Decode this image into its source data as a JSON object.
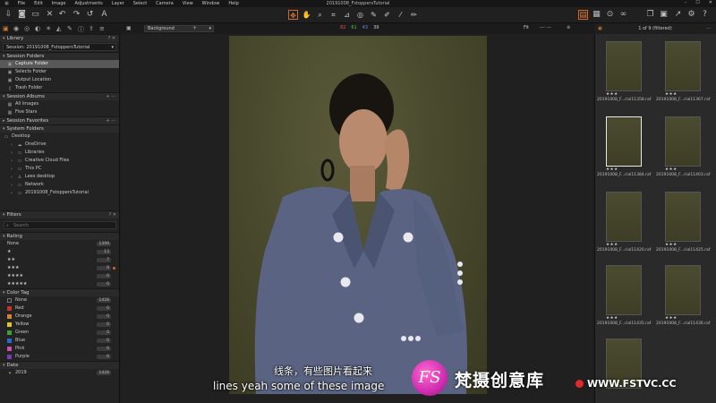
{
  "window": {
    "title": "20191008_FstoppersTutorial",
    "menu": [
      "File",
      "Edit",
      "Image",
      "Adjustments",
      "Layer",
      "Select",
      "Camera",
      "View",
      "Window",
      "Help"
    ],
    "controls": [
      "–",
      "☐",
      "✕"
    ]
  },
  "viewer": {
    "background_select": "Background",
    "rgb": {
      "r": "82",
      "g": "61",
      "b": "43",
      "l": "39"
    },
    "fit_label": "Fit"
  },
  "browser": {
    "counter": "1 of 9 (filtered)",
    "thumbnails": [
      {
        "name": "20191008_F...rial11358.raf",
        "stars": "★★★"
      },
      {
        "name": "20191008_F...rial11367.raf",
        "stars": "★★★"
      },
      {
        "name": "20191008_F...rial11384.raf",
        "stars": "★★★"
      },
      {
        "name": "20191008_F...rial11403.raf",
        "stars": "★★★"
      },
      {
        "name": "20191008_F...rial11420.raf",
        "stars": "★★★"
      },
      {
        "name": "20191008_F...rial11425.raf",
        "stars": "★★★"
      },
      {
        "name": "20191008_F...rial11435.raf",
        "stars": "★★★"
      },
      {
        "name": "20191008_F...rial11436.raf",
        "stars": "★★★"
      },
      {
        "name": "",
        "stars": ""
      }
    ]
  },
  "library": {
    "header": "Library",
    "session": "Session: 20191008_FstoppersTutorial",
    "session_folders": {
      "header": "Session Folders",
      "items": [
        "Capture Folder",
        "Selects Folder",
        "Output Location",
        "Trash Folder"
      ]
    },
    "session_albums": {
      "header": "Session Albums",
      "items": [
        "All Images",
        "Five Stars"
      ]
    },
    "session_favorites": "Session Favorites",
    "system_folders": {
      "header": "System Folders",
      "items": [
        "Desktop",
        "OneDrive",
        "Libraries",
        "Creative Cloud Files",
        "This PC",
        "Lees desktop",
        "Network",
        "20191008_FstoppersTutorial"
      ]
    }
  },
  "filters": {
    "header": "Filters",
    "search_placeholder": "Search",
    "rating": {
      "header": "Rating",
      "items": [
        {
          "label": "None",
          "count": "1399"
        },
        {
          "label": "★",
          "count": "13"
        },
        {
          "label": "★★",
          "count": "7"
        },
        {
          "label": "★★★",
          "count": "9"
        },
        {
          "label": "★★★★",
          "count": "0"
        },
        {
          "label": "★★★★★",
          "count": "0"
        }
      ]
    },
    "color_tag": {
      "header": "Color Tag",
      "items": [
        {
          "label": "None",
          "count": "1428",
          "color": "#2a2a2a"
        },
        {
          "label": "Red",
          "count": "0",
          "color": "#c8302a"
        },
        {
          "label": "Orange",
          "count": "0",
          "color": "#d8822a"
        },
        {
          "label": "Yellow",
          "count": "0",
          "color": "#d8c82a"
        },
        {
          "label": "Green",
          "count": "0",
          "color": "#3aa03a"
        },
        {
          "label": "Blue",
          "count": "0",
          "color": "#2a6ad0"
        },
        {
          "label": "Pink",
          "count": "0",
          "color": "#d04ab0"
        },
        {
          "label": "Purple",
          "count": "0",
          "color": "#7a3ac0"
        }
      ]
    },
    "date": {
      "header": "Date",
      "items": [
        {
          "label": "2019",
          "count": "1428"
        }
      ]
    }
  },
  "subtitles": {
    "chinese": "线条，有些图片看起来",
    "english": "lines yeah some of these image"
  },
  "watermark": {
    "logo": "FS",
    "brand_cn": "梵摄创意库",
    "url": "WWW.FSTVC.CC"
  },
  "colors": {
    "accent": "#d06a2a",
    "selected_row": "#595959",
    "panel": "#232323"
  }
}
